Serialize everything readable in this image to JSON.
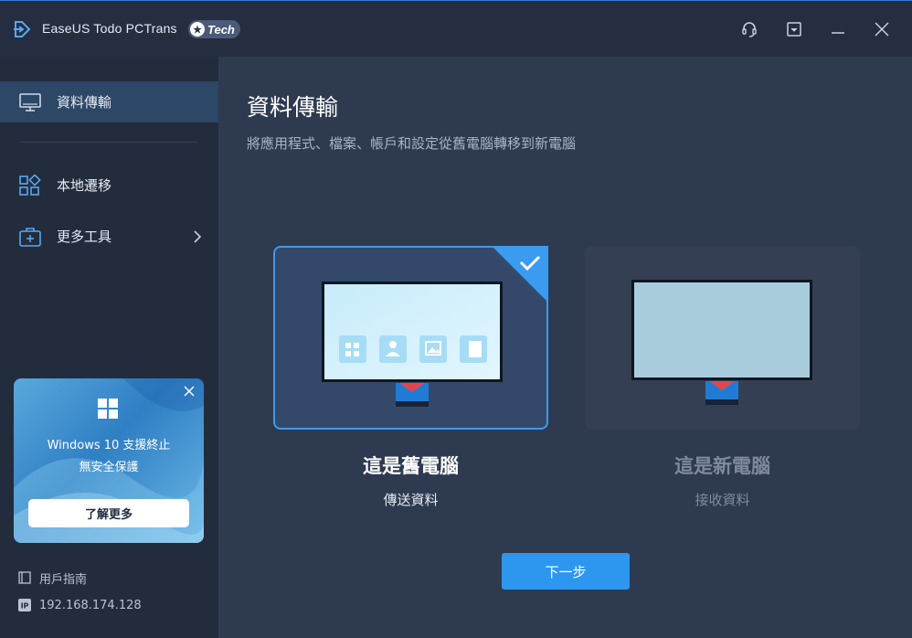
{
  "app": {
    "title": "EaseUS Todo PCTrans",
    "edition_badge": "Tech"
  },
  "titlebar": {
    "icons": [
      "headset-icon",
      "dropdown-menu-icon",
      "minimize-icon",
      "close-icon"
    ]
  },
  "sidebar": {
    "items": [
      {
        "label": "資料傳輸",
        "icon": "monitor-icon",
        "active": true
      },
      {
        "label": "本地遷移",
        "icon": "apps-grid-icon",
        "active": false
      },
      {
        "label": "更多工具",
        "icon": "toolbox-icon",
        "active": false,
        "has_submenu": true
      }
    ],
    "promo": {
      "line1": "Windows 10 支援終止",
      "line2": "無安全保護",
      "button": "了解更多"
    },
    "footer": {
      "guide": "用戶指南",
      "ip": "192.168.174.128"
    }
  },
  "main": {
    "title": "資料傳輸",
    "subtitle": "將應用程式、檔案、帳戶和設定從舊電腦轉移到新電腦",
    "options": [
      {
        "title": "這是舊電腦",
        "subtitle": "傳送資料",
        "selected": true
      },
      {
        "title": "這是新電腦",
        "subtitle": "接收資料",
        "selected": false
      }
    ],
    "next_button": "下一步"
  },
  "colors": {
    "accent": "#2d97ef",
    "selected_border": "#3b9bf0",
    "sidebar_bg": "#222c3d",
    "main_bg": "#2e3a50"
  }
}
